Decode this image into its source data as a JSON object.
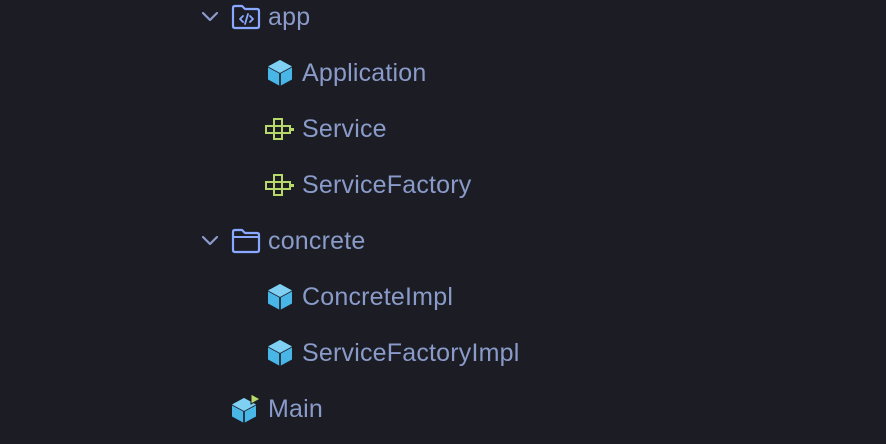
{
  "project_tree": {
    "app_folder": {
      "name": "app",
      "icon": "source-package-icon",
      "expanded": true,
      "children": [
        {
          "name": "Application",
          "icon": "class-icon"
        },
        {
          "name": "Service",
          "icon": "interface-icon"
        },
        {
          "name": "ServiceFactory",
          "icon": "interface-icon"
        }
      ]
    },
    "concrete_folder": {
      "name": "concrete",
      "icon": "folder-icon",
      "expanded": true,
      "children": [
        {
          "name": "ConcreteImpl",
          "icon": "class-icon"
        },
        {
          "name": "ServiceFactoryImpl",
          "icon": "class-icon"
        }
      ]
    },
    "main_file": {
      "name": "Main",
      "icon": "runnable-class-icon"
    }
  },
  "colors": {
    "background": "#1b1c24",
    "text": "#8a9bc9",
    "class_icon": "#48b6e6",
    "interface_icon": "#b8d86a",
    "folder_icon": "#8aa8ff",
    "chevron": "#8a9bc9"
  }
}
